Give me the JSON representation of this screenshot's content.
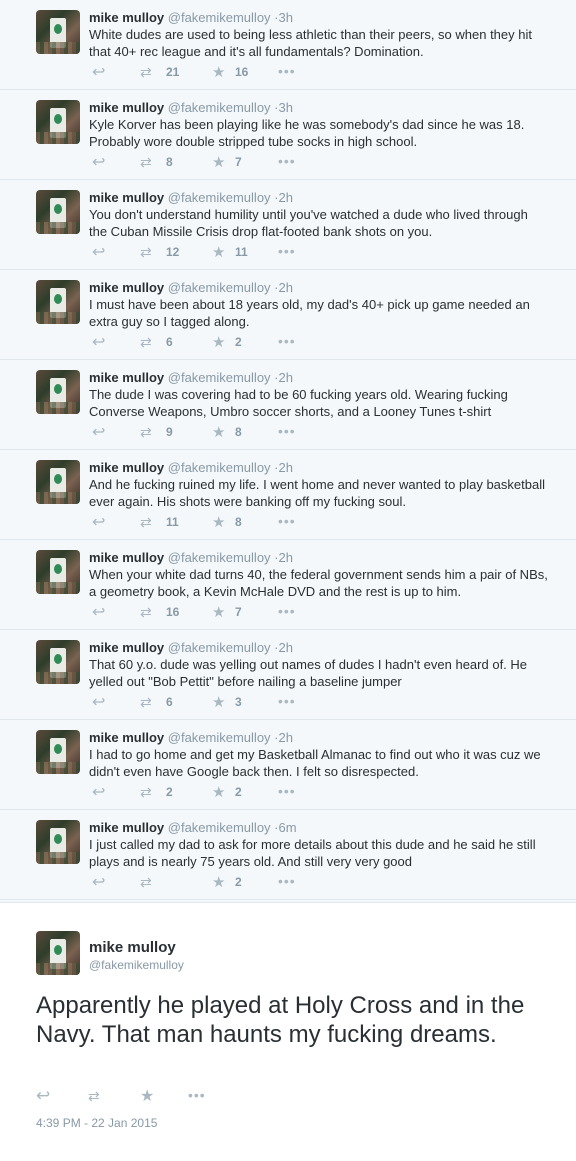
{
  "user": {
    "name": "mike mulloy",
    "handle": "@fakemikemulloy"
  },
  "icons": {
    "reply": "reply-icon",
    "retweet": "retweet-icon",
    "favorite": "star-icon",
    "more": "more-icon"
  },
  "tweets": [
    {
      "time": "3h",
      "text": "White dudes are used to being less athletic than their peers, so when they hit that 40+ rec league and it's all fundamentals? Domination.",
      "retweets": "21",
      "favorites": "16"
    },
    {
      "time": "3h",
      "text": "Kyle Korver has been playing like he was somebody's dad since he was 18. Probably wore double stripped tube socks in high school.",
      "retweets": "8",
      "favorites": "7"
    },
    {
      "time": "2h",
      "text": "You don't understand humility until you've watched a dude who lived through the Cuban Missile Crisis drop flat-footed bank shots on you.",
      "retweets": "12",
      "favorites": "11"
    },
    {
      "time": "2h",
      "text": "I must have been about 18 years old, my dad's 40+ pick up game needed an extra guy so I tagged along.",
      "retweets": "6",
      "favorites": "2"
    },
    {
      "time": "2h",
      "text": "The dude I was covering had to be 60 fucking years old. Wearing fucking Converse Weapons, Umbro soccer shorts, and a Looney Tunes t-shirt",
      "retweets": "9",
      "favorites": "8"
    },
    {
      "time": "2h",
      "text": "And he fucking ruined my life. I went home and never wanted to play basketball ever again. His shots were banking off my fucking soul.",
      "retweets": "11",
      "favorites": "8"
    },
    {
      "time": "2h",
      "text": "When your white dad turns 40, the federal government sends him a pair of NBs, a geometry book, a Kevin McHale DVD and the rest is up to him.",
      "retweets": "16",
      "favorites": "7"
    },
    {
      "time": "2h",
      "text": "That 60 y.o. dude was yelling out names of dudes I hadn't even heard of. He yelled out \"Bob Pettit\" before nailing a baseline jumper",
      "retweets": "6",
      "favorites": "3"
    },
    {
      "time": "2h",
      "text": "I had to go home and get my Basketball Almanac to find out who it was cuz we didn't even have Google back then.  I felt so disrespected.",
      "retweets": "2",
      "favorites": "2"
    },
    {
      "time": "6m",
      "text": "I just called my dad to ask for more details about this dude and he said he still plays and is nearly 75 years old. And still very very good",
      "retweets": "",
      "favorites": "2"
    }
  ],
  "main_tweet": {
    "name": "mike mulloy",
    "handle": "@fakemikemulloy",
    "text": "Apparently he played at Holy Cross and in the Navy.  That man haunts my fucking dreams.",
    "timestamp": "4:39 PM - 22 Jan 2015"
  }
}
